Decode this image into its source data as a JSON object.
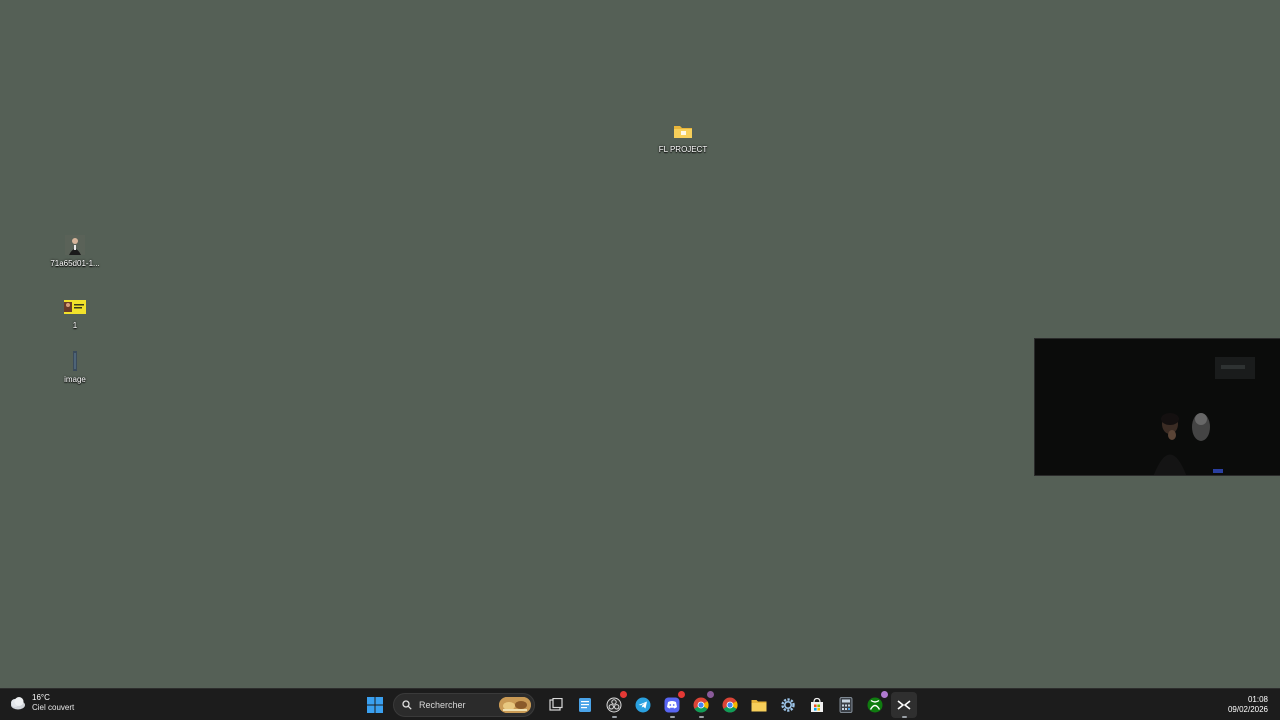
{
  "desktop": {
    "background_color": "#556056",
    "icons": [
      {
        "label": "FL PROJECT",
        "icon": "folder-icon"
      },
      {
        "label": "71a65d01-1...",
        "icon": "image-thumbnail-icon"
      },
      {
        "label": "1",
        "icon": "image-thumbnail-icon"
      },
      {
        "label": "image",
        "icon": "image-thumbnail-icon"
      }
    ]
  },
  "webcam_overlay": {
    "icon": "webcam-feed"
  },
  "taskbar": {
    "weather": {
      "temperature": "16°C",
      "condition": "Ciel couvert",
      "icon": "cloud-icon"
    },
    "search": {
      "placeholder": "Rechercher",
      "icon": "search-icon"
    },
    "apps": [
      {
        "name": "start",
        "icon": "windows-start-icon"
      },
      {
        "name": "task-view",
        "icon": "task-view-icon"
      },
      {
        "name": "notepad",
        "icon": "notepad-icon"
      },
      {
        "name": "obs",
        "icon": "obs-icon"
      },
      {
        "name": "telegram",
        "icon": "telegram-icon"
      },
      {
        "name": "discord",
        "icon": "discord-icon"
      },
      {
        "name": "chrome-profile",
        "icon": "chrome-icon"
      },
      {
        "name": "chrome",
        "icon": "chrome-icon"
      },
      {
        "name": "file-explorer",
        "icon": "folder-icon"
      },
      {
        "name": "settings",
        "icon": "gear-icon"
      },
      {
        "name": "microsoft-store",
        "icon": "store-icon"
      },
      {
        "name": "calculator",
        "icon": "calculator-icon"
      },
      {
        "name": "xbox",
        "icon": "xbox-icon"
      },
      {
        "name": "capcut",
        "icon": "capcut-icon"
      }
    ],
    "clock": {
      "time": "01:08",
      "date": "09/02/2026"
    }
  }
}
